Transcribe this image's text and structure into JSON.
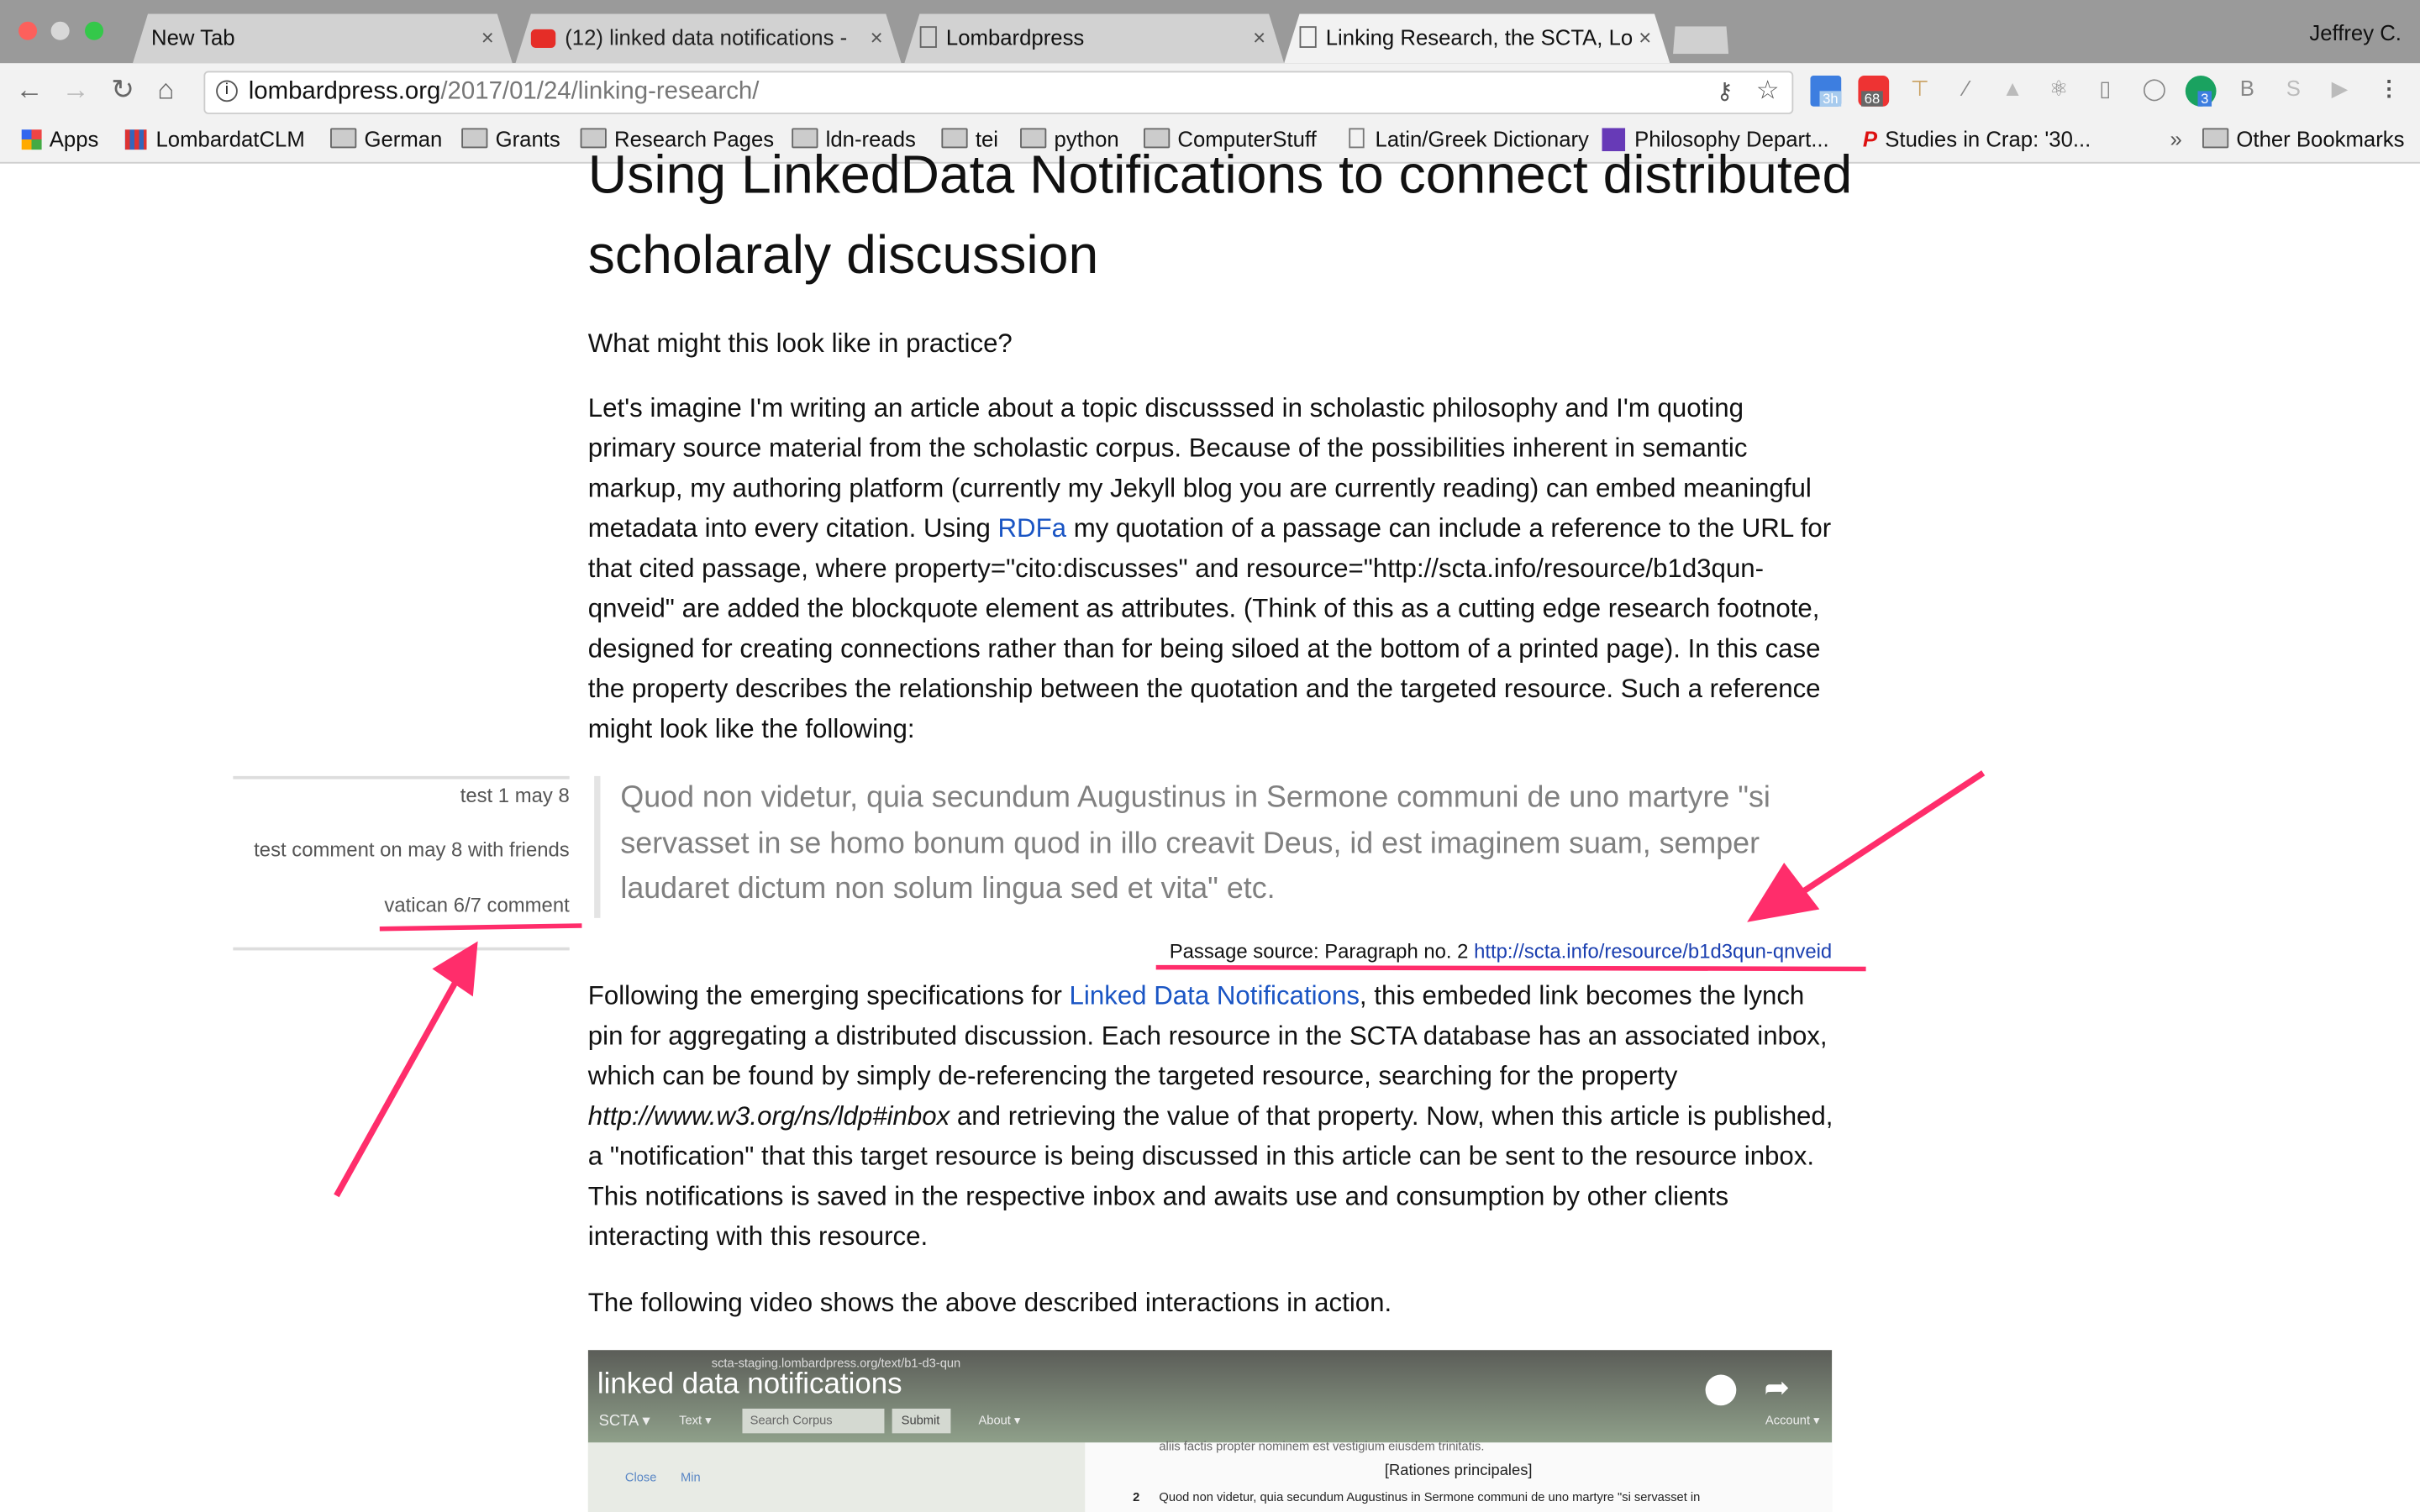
{
  "browser": {
    "tabs": [
      {
        "label": "New Tab",
        "icon": "none"
      },
      {
        "label": "(12) linked data notifications -",
        "icon": "youtube-icon"
      },
      {
        "label": "Lombardpress",
        "icon": "page-icon"
      },
      {
        "label": "Linking Research, the SCTA, Lo",
        "icon": "page-icon",
        "active": true
      }
    ],
    "profile": "Jeffrey C.",
    "url_host": "lombardpress.org",
    "url_path": "/2017/01/24/linking-research/",
    "extension_badges": {
      "calendar": "3h",
      "adblock": "68",
      "grammarly": "3"
    },
    "bookmarks": [
      "Apps",
      "LombardatCLM",
      "German",
      "Grants",
      "Research Pages",
      "ldn-reads",
      "tei",
      "python",
      "ComputerStuff",
      "Latin/Greek Dictionary",
      "Philosophy Depart...",
      "Studies in Crap: '30..."
    ],
    "overflow": "»",
    "other_bookmarks": "Other Bookmarks"
  },
  "article": {
    "title": "Using LinkedData Notifications to connect distributed scholaraly discussion",
    "q": "What might this look like in practice?",
    "p1_a": "Let's imagine I'm writing an article about a topic discusssed in scholastic philosophy and I'm quoting primary source material from the scholastic corpus. Because of the possibilities inherent in semantic markup, my authoring platform (currently my Jekyll blog you are currently reading) can embed meaningful metadata into every citation. Using ",
    "p1_link": "RDFa",
    "p1_b": " my quotation of a passage can include a reference to the URL for that cited passage, where property=\"cito:discusses\" and resource=\"http://scta.info/resource/b1d3qun-qnveid\" are added the blockquote element as attributes. (Think of this as a cutting edge research footnote, designed for creating connections rather than for being siloed at the bottom of a printed page). In this case the property describes the relationship between the quotation and the targeted resource. Such a reference might look like the following:",
    "quote": "Quod non videtur, quia secundum Augustinus in Sermone communi de uno martyre \"si servasset in se homo bonum quod in illo creavit Deus, id est imaginem suam, semper laudaret dictum non solum lingua sed et vita\" etc.",
    "source_label": "Passage source: Paragraph no. 2 ",
    "source_link": "http://scta.info/resource/b1d3qun-qnveid",
    "comments": [
      "test 1 may 8",
      "test comment on may 8 with friends",
      "vatican 6/7 comment"
    ],
    "p2_a": "Following the emerging specifications for ",
    "p2_link": "Linked Data Notifications",
    "p2_b": ", this embeded link becomes the lynch pin for aggregating a distributed discussion. Each resource in the SCTA database has an associated inbox, which can be found by simply de-referencing the targeted resource, searching for the property ",
    "p2_em": "http://www.w3.org/ns/ldp#inbox",
    "p2_c": " and retrieving the value of that property. Now, when this article is published, a \"notification\" that this target resource is being discussed in this article can be sent to the resource inbox. This notifications is saved in the respective inbox and awaits use and consumption by other clients interacting with this resource.",
    "p3": "The following video shows the above described interactions in action."
  },
  "video": {
    "title": "linked data notifications",
    "inner_url": "scta-staging.lombardpress.org/text/b1-d3-qun",
    "nav": [
      "SCTA ▾",
      "Text ▾",
      "About ▾",
      "Account ▾"
    ],
    "search_placeholder": "Search Corpus",
    "submit": "Submit",
    "side_links": [
      "Close",
      "Min"
    ],
    "heading": "[Rationes principales]",
    "para_num": "2",
    "para_text": "Quod non videtur, quia secundum Augustinus in Sermone communi de uno martyre \"si servasset in",
    "prev_line": "aliis factis propter nominem est vestigium eiusdem trinitatis."
  },
  "colors": {
    "annotation": "#ff2d6b",
    "link": "#1a55c4",
    "quote_text": "#808080"
  }
}
